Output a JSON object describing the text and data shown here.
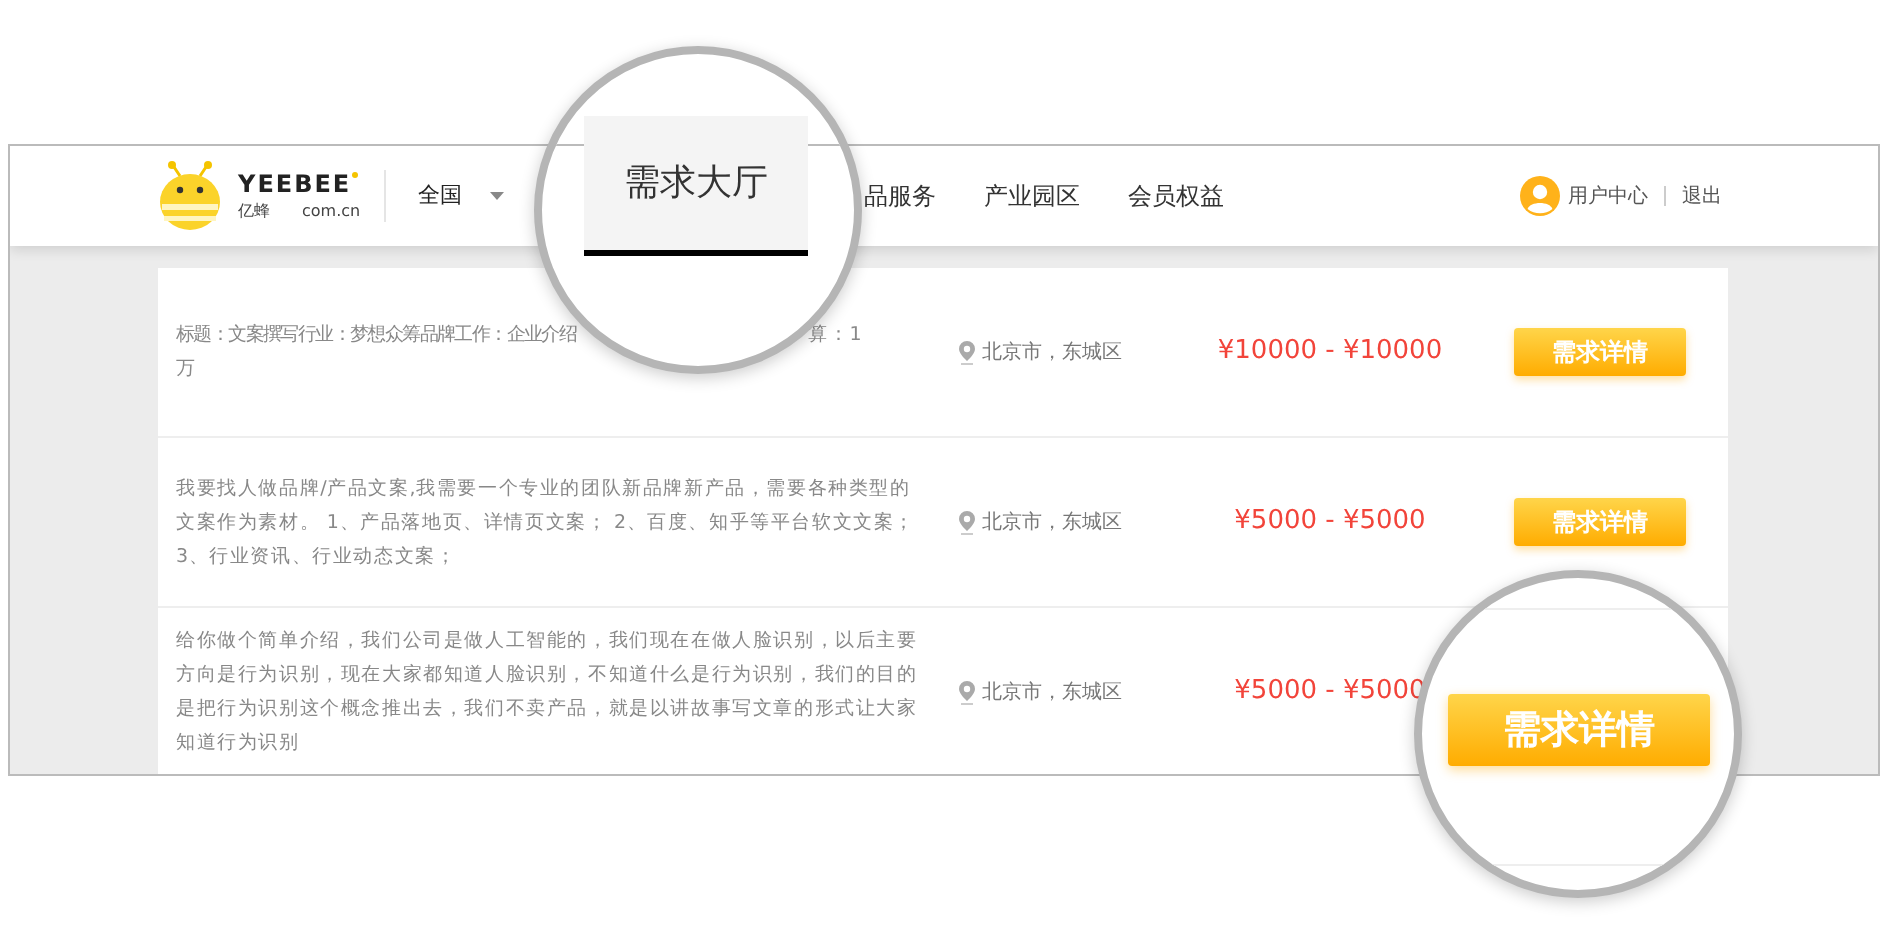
{
  "logo": {
    "wordmark": "YEEBEE",
    "chinese": "亿蜂",
    "domain": "com.cn"
  },
  "region_select": {
    "label": "全国"
  },
  "nav": [
    {
      "label": "需求大厅",
      "selected": true
    },
    {
      "label": "品服务",
      "selected": false
    },
    {
      "label": "产业园区",
      "selected": false
    },
    {
      "label": "会员权益",
      "selected": false
    }
  ],
  "user_menu": {
    "user_center": "用户中心",
    "logout": "退出"
  },
  "rows": [
    {
      "description": [
        "标题：文案撰写行业：梦想众筹品牌工作：企业介绍",
        "算：1",
        "万"
      ],
      "location": "北京市，东城区",
      "price": "¥10000 - ¥10000",
      "button": "需求详情"
    },
    {
      "description": [
        "我要找人做品牌/产品文案,我需要一个专业的团队新品牌新产品，需要各种类型的文案作为素材。 1、产品落地页、详情页文案； 2、百度、知乎等平台软文文案； 3、行业资讯、行业动态文案；"
      ],
      "location": "北京市，东城区",
      "price": "¥5000 - ¥5000",
      "button": "需求详情"
    },
    {
      "description": [
        "给你做个简单介绍，我们公司是做人工智能的，我们现在在做人脸识别，以后主要方向是行为识别，现在大家都知道人脸识别，不知道什么是行为识别，我们的目的是把行为识别这个概念推出去，我们不卖产品，就是以讲故事写文章的形式让大家知道行为识别"
      ],
      "location": "北京市，东城区",
      "price": "¥5000 - ¥5000"
    }
  ],
  "magnified_button": "需求详情"
}
